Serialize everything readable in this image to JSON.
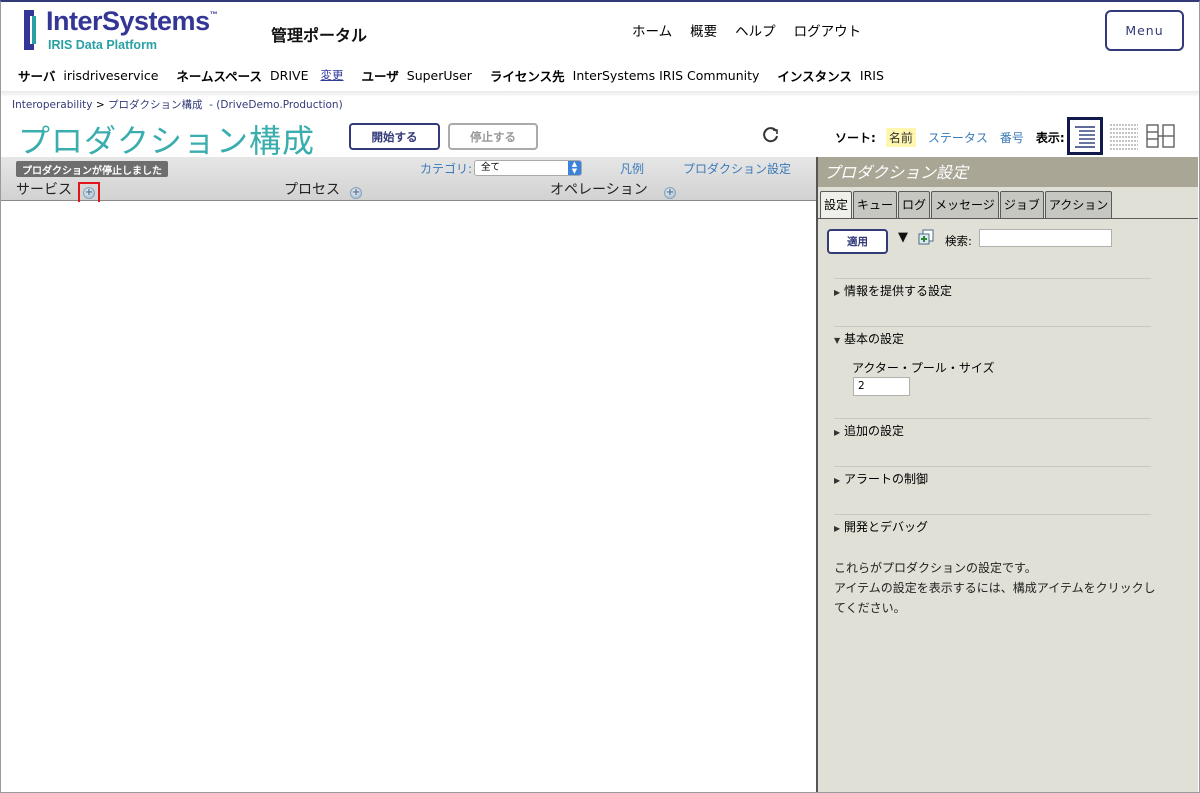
{
  "header": {
    "logo_word": "InterSystems",
    "logo_tm": "™",
    "logo_sub": "IRIS Data Platform",
    "portal_title": "管理ポータル",
    "nav": [
      "ホーム",
      "概要",
      "ヘルプ",
      "ログアウト"
    ],
    "menu_label": "Menu"
  },
  "infobar": {
    "server_label": "サーバ",
    "server_value": "irisdriveservice",
    "namespace_label": "ネームスペース",
    "namespace_value": "DRIVE",
    "change_link": "変更",
    "user_label": "ユーザ",
    "user_value": "SuperUser",
    "license_label": "ライセンス先",
    "license_value": "InterSystems IRIS Community",
    "instance_label": "インスタンス",
    "instance_value": "IRIS"
  },
  "breadcrumb": {
    "root": "Interoperability",
    "sep": ">",
    "page": "プロダクション構成",
    "production": "- (DriveDemo.Production)"
  },
  "page": {
    "title": "プロダクション構成",
    "start_button": "開始する",
    "stop_button": "停止する"
  },
  "sort": {
    "label": "ソート:",
    "options": [
      "名前",
      "ステータス",
      "番号"
    ],
    "selected": "名前",
    "view_label": "表示:"
  },
  "left_panel": {
    "status_badge": "プロダクションが停止しました",
    "category_label": "カテゴリ:",
    "category_value": "全て",
    "legend_link": "凡例",
    "settings_link": "プロダクション設定",
    "columns": [
      "サービス",
      "プロセス",
      "オペレーション"
    ]
  },
  "right_panel": {
    "title": "プロダクション設定",
    "tabs": [
      "設定",
      "キュー",
      "ログ",
      "メッセージ",
      "ジョブ",
      "アクション"
    ],
    "selected_tab": "設定",
    "apply_button": "適用",
    "search_label": "検索:",
    "search_value": "",
    "sections": [
      "情報を提供する設定",
      "基本の設定",
      "追加の設定",
      "アラートの制御",
      "開発とデバッグ"
    ],
    "expanded_section": "基本の設定",
    "field_label": "アクター・プール・サイズ",
    "field_value": "2",
    "note_line1": "これらがプロダクションの設定です。",
    "note_line2": "アイテムの設定を表示するには、構成アイテムをクリックしてください。"
  },
  "colors": {
    "brand": "#333695",
    "teal": "#3aaeae",
    "link": "#3a7aba",
    "highlight": "#e0161a",
    "panel_bg": "#e0e0d6",
    "panel_title": "#a9a696"
  },
  "icons": [
    "logo-mark",
    "refresh-icon",
    "view-list-icon",
    "view-grid-icon",
    "view-columns-icon",
    "add-icon",
    "expand-all-icon",
    "triangle-down-icon"
  ]
}
